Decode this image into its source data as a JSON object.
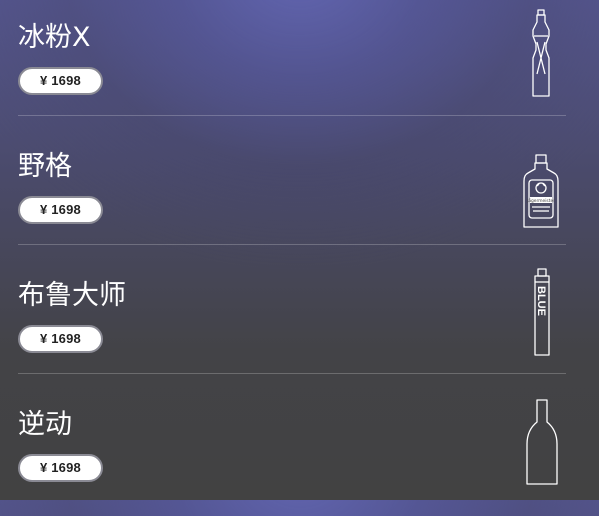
{
  "products": [
    {
      "name": "冰粉X",
      "price": "¥ 1698",
      "icon": "bottle-x-icon"
    },
    {
      "name": "野格",
      "price": "¥ 1698",
      "icon": "bottle-jagermeister-icon",
      "bottle_label": "Jägermeister"
    },
    {
      "name": "布鲁大师",
      "price": "¥ 1698",
      "icon": "bottle-blue-icon",
      "bottle_label": "BLUE"
    },
    {
      "name": "逆动",
      "price": "¥ 1698",
      "icon": "bottle-plain-icon"
    }
  ],
  "colors": {
    "text": "#ffffff",
    "price_bg": "#ffffff",
    "price_text": "#222222",
    "background_top": "#55568f",
    "background_bottom": "#424242"
  }
}
